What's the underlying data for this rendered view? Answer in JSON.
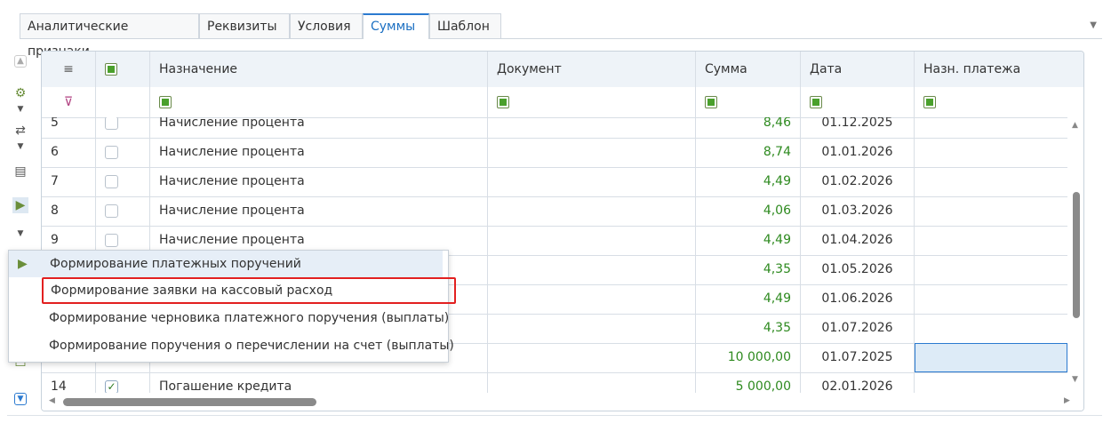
{
  "tabs": [
    "Аналитические признаки",
    "Реквизиты",
    "Условия",
    "Суммы",
    "Шаблон"
  ],
  "active_tab": "Суммы",
  "columns": {
    "menu_icon": "≡",
    "assignment": "Назначение",
    "document": "Документ",
    "amount": "Сумма",
    "date": "Дата",
    "payment_purpose": "Назн. платежа"
  },
  "rows": [
    {
      "num": "5",
      "checked": false,
      "assignment": "Начисление процента",
      "amount": "8,46",
      "date": "01.12.2025"
    },
    {
      "num": "6",
      "checked": false,
      "assignment": "Начисление процента",
      "amount": "8,74",
      "date": "01.01.2026"
    },
    {
      "num": "7",
      "checked": false,
      "assignment": "Начисление процента",
      "amount": "4,49",
      "date": "01.02.2026"
    },
    {
      "num": "8",
      "checked": false,
      "assignment": "Начисление процента",
      "amount": "4,06",
      "date": "01.03.2026"
    },
    {
      "num": "9",
      "checked": false,
      "assignment": "Начисление процента",
      "amount": "4,49",
      "date": "01.04.2026"
    },
    {
      "num": "",
      "checked": false,
      "assignment": "",
      "amount": "4,35",
      "date": "01.05.2026"
    },
    {
      "num": "",
      "checked": false,
      "assignment": "",
      "amount": "4,49",
      "date": "01.06.2026"
    },
    {
      "num": "",
      "checked": false,
      "assignment": "",
      "amount": "4,35",
      "date": "01.07.2026"
    },
    {
      "num": "",
      "checked": false,
      "assignment": "",
      "amount": "10 000,00",
      "date": "01.07.2025"
    },
    {
      "num": "14",
      "checked": true,
      "assignment": "Погашение кредита",
      "amount": "5 000,00",
      "date": "02.01.2026"
    }
  ],
  "menu": {
    "items": [
      "Формирование платежных поручений",
      "Формирование заявки на кассовый расход",
      "Формирование черновика платежного поручения (выплаты)",
      "Формирование поручения о перечислении на счет (выплаты)"
    ]
  },
  "icons": {
    "settings": "gear-icon",
    "doc_action": "document-forward-icon",
    "filter": "filter-off-icon"
  },
  "colors": {
    "accent": "#2b7ad0",
    "amount_green": "#2e8a1f",
    "highlight_red": "#e22020"
  }
}
